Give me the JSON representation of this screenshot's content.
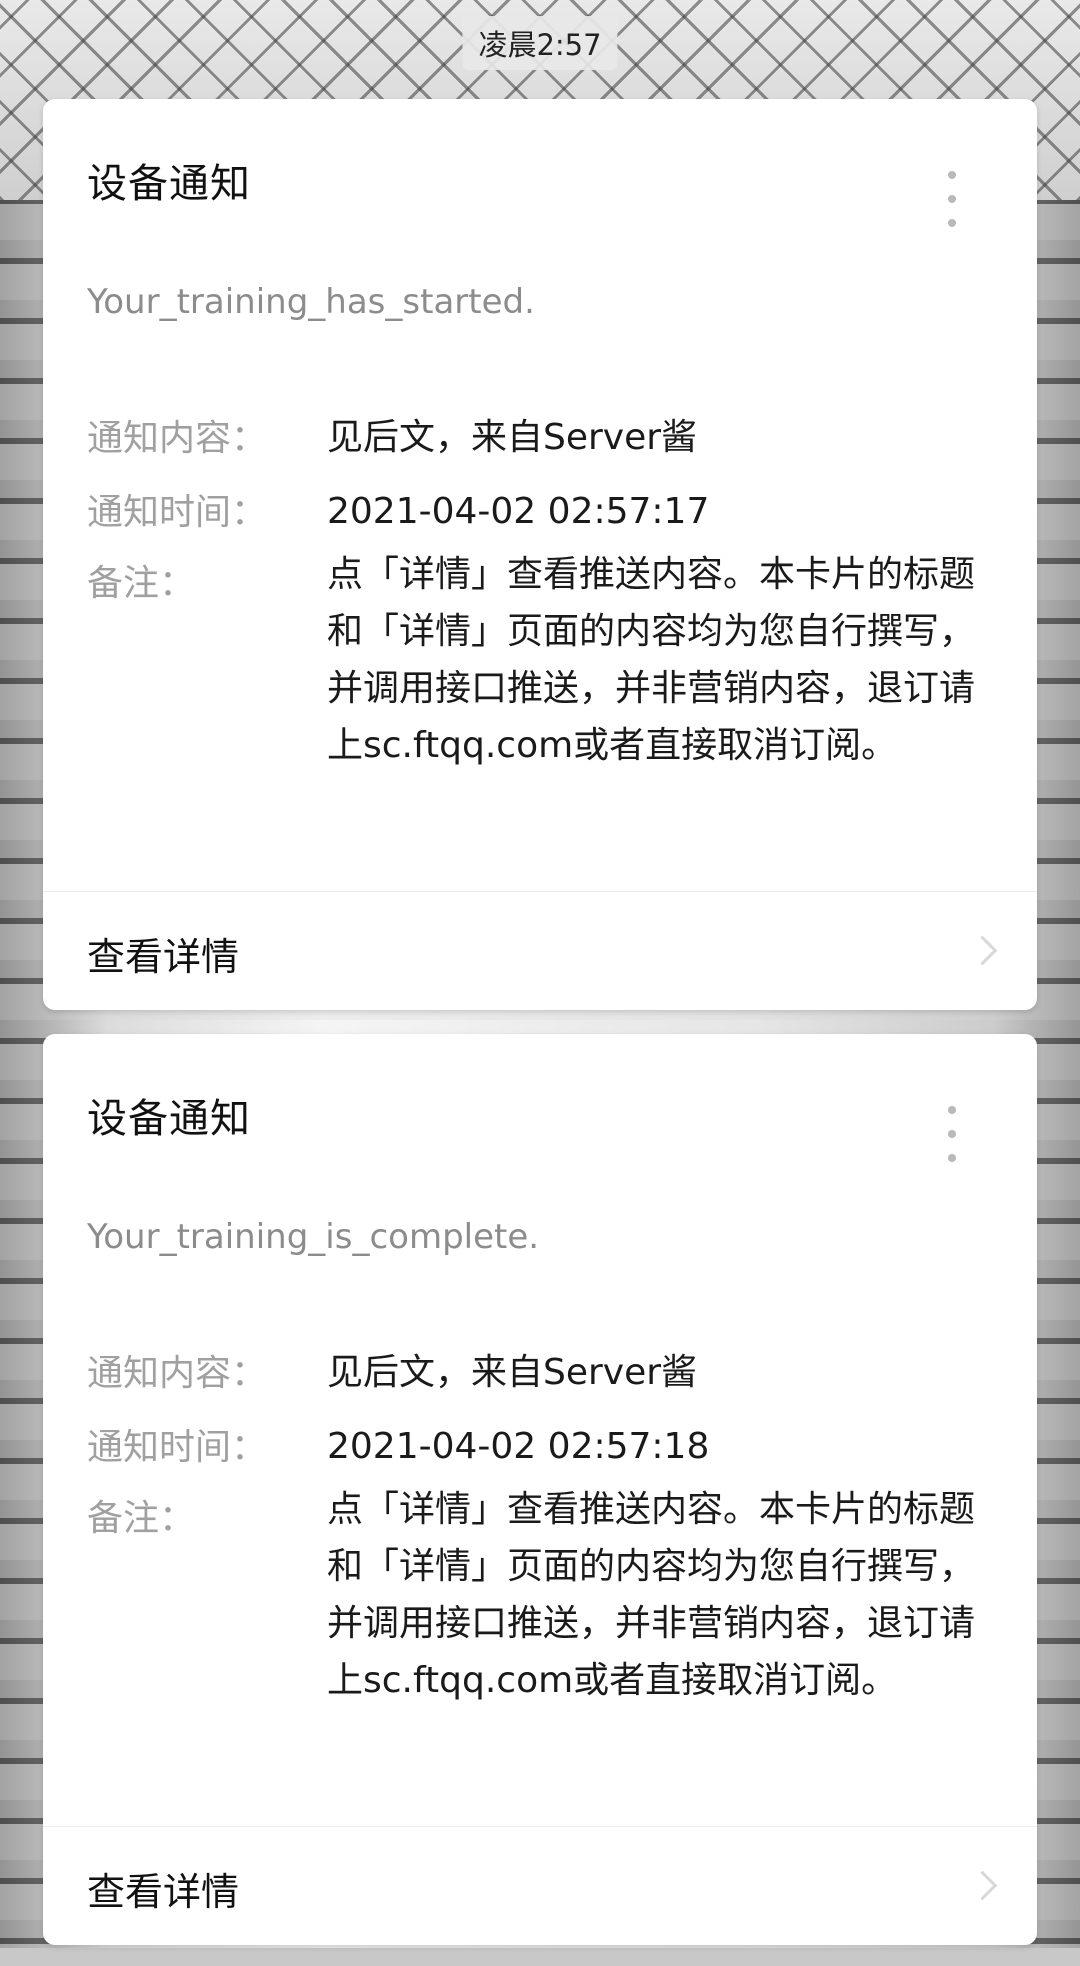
{
  "status_bar": {
    "time": "凌晨2:57"
  },
  "labels": {
    "content_label": "通知内容：",
    "time_label": "通知时间：",
    "note_label": "备注："
  },
  "cards": [
    {
      "title": "设备通知",
      "subtitle": "Your_training_has_started.",
      "content_value": "见后文，来自Server酱",
      "time_value": "2021-04-02 02:57:17",
      "note_value": "点「详情」查看推送内容。本卡片的标题和「详情」页面的内容均为您自行撰写，并调用接口推送，并非营销内容，退订请上sc.ftqq.com或者直接取消订阅。",
      "detail_label": "查看详情"
    },
    {
      "title": "设备通知",
      "subtitle": "Your_training_is_complete.",
      "content_value": "见后文，来自Server酱",
      "time_value": "2021-04-02 02:57:18",
      "note_value": "点「详情」查看推送内容。本卡片的标题和「详情」页面的内容均为您自行撰写，并调用接口推送，并非营销内容，退订请上sc.ftqq.com或者直接取消订阅。",
      "detail_label": "查看详情"
    }
  ],
  "icons": {
    "more": "more-vertical-icon",
    "chevron": "chevron-right-icon"
  },
  "colors": {
    "card_bg": "#ffffff",
    "title": "#111111",
    "subtitle": "#8c8c8c",
    "label": "#a0a0a0",
    "chevron": "#d8d8d8"
  }
}
